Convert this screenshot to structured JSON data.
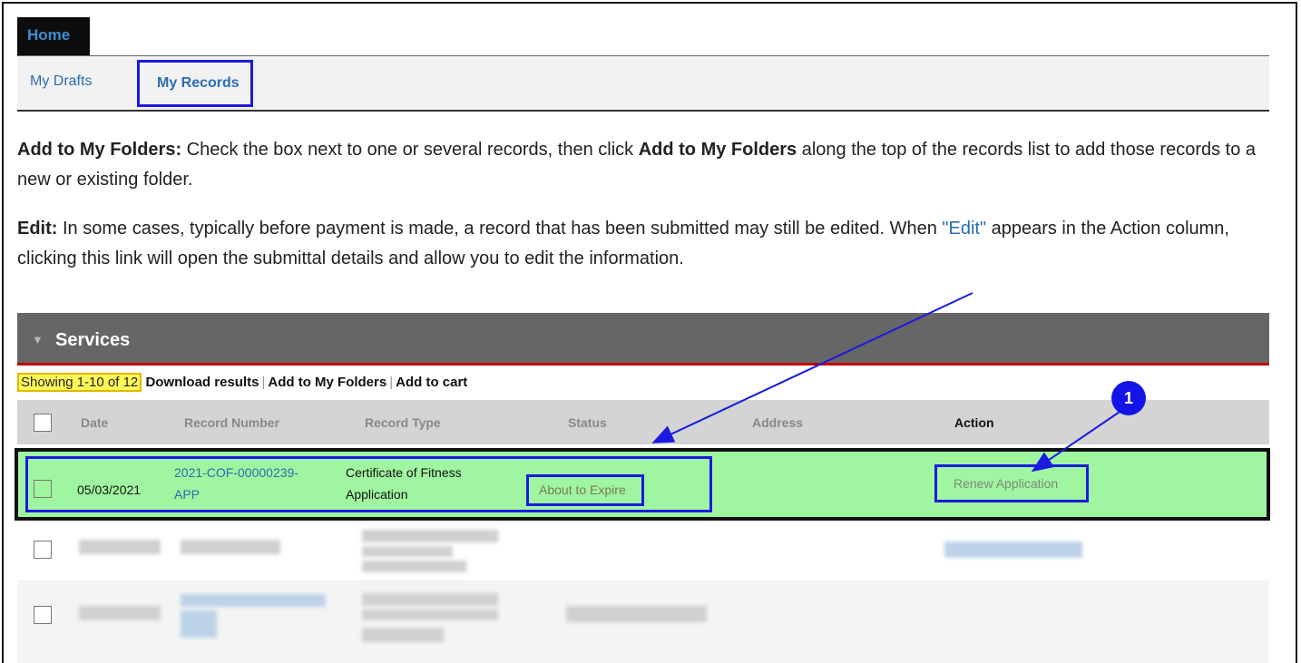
{
  "nav": {
    "home_tab": "Home",
    "my_drafts": "My Drafts",
    "my_records": "My Records"
  },
  "instructions": {
    "add_heading": "Add to My Folders:",
    "add_text_1": " Check the box next to one or several records, then click ",
    "add_bold": "Add to My Folders",
    "add_text_2": " along the top of the records list to add those records to a new or existing folder.",
    "edit_heading": "Edit:",
    "edit_text_1": " In some cases, typically before payment is made, a record that has been submitted may still be edited. When ",
    "edit_link": "\"Edit\"",
    "edit_text_2": " appears in the Action column, clicking this link will open the submittal details and allow you to edit the information."
  },
  "services": {
    "title": "Services",
    "showing": "Showing 1-10 of 12",
    "download": "Download results",
    "add_folders": "Add to My Folders",
    "add_cart": "Add to cart"
  },
  "table": {
    "columns": [
      "Date",
      "Record Number",
      "Record Type",
      "Status",
      "Address",
      "Action"
    ],
    "highlighted_row": {
      "date": "05/03/2021",
      "record_number_line1": "2021-COF-00000239-",
      "record_number_line2": "APP",
      "record_type_line1": "Certificate of Fitness",
      "record_type_line2": "Application",
      "status": "About to Expire",
      "action": "Renew Application"
    }
  },
  "annotation": {
    "badge_number": "1"
  },
  "colors": {
    "highlight_row": "#a0f5a0",
    "annotation_blue": "#1a1ae0",
    "services_bar": "#666666",
    "link_blue": "#2a6db0"
  }
}
